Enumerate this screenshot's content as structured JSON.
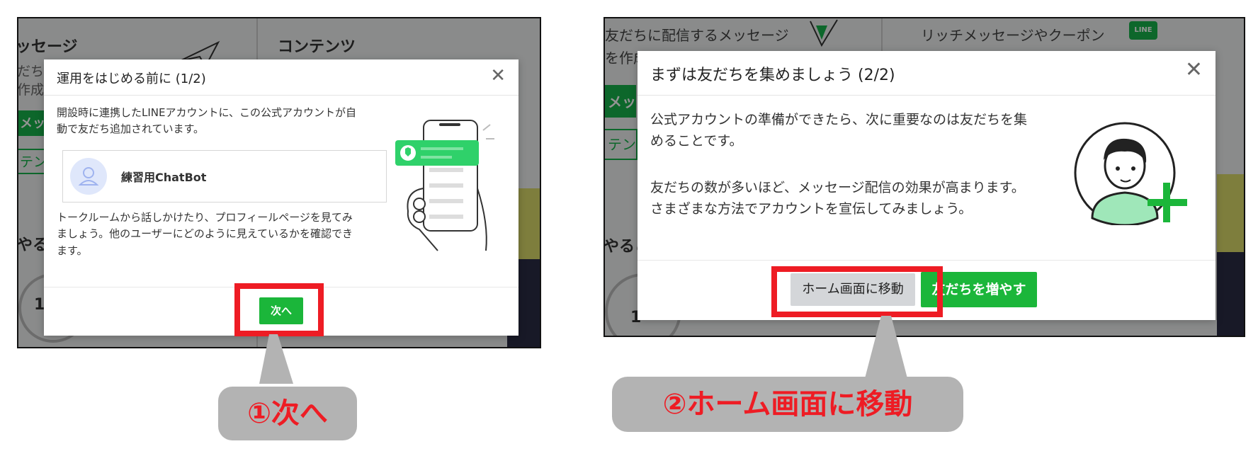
{
  "panel1": {
    "bg": {
      "heading_left": "ッセージ",
      "heading_right": "コンテンツ",
      "snippet1": "だち",
      "snippet2": "作成",
      "tab1": "メッ",
      "tab2": "テン",
      "section": "やるこ",
      "circle_number": "1"
    },
    "modal": {
      "title": "運用をはじめる前に (1/2)",
      "paragraph1_line1": "開設時に連携したLINEアカウントに、この公式アカウントが自",
      "paragraph1_line2": "動で友だち追加されています。",
      "account_name": "練習用ChatBot",
      "paragraph2_line1": "トークルームから話しかけたり、プロフィールページを見てみ",
      "paragraph2_line2": "ましょう。他のユーザーにどのように見えているかを確認でき",
      "paragraph2_line3": "ます。",
      "next_button": "次へ"
    }
  },
  "panel2": {
    "bg": {
      "line1_left": "友だちに配信するメッセージ",
      "line2_left": "を作成",
      "line1_right": "リッチメッセージやクーポン",
      "line_badge": "LINE",
      "tab1": "メッ",
      "tab2": "テン",
      "section": "やるこ",
      "circle_number": "1"
    },
    "modal": {
      "title": "まずは友だちを集めましょう (2/2)",
      "paragraph1_line1": "公式アカウントの準備ができたら、次に重要なのは友だちを集",
      "paragraph1_line2": "めることです。",
      "paragraph2_line1": "友だちの数が多いほど、メッセージ配信の効果が高まります。",
      "paragraph2_line2": "さまざまな方法でアカウントを宣伝してみましょう。",
      "home_button": "ホーム画面に移動",
      "add_friends_button": "友だちを増やす"
    }
  },
  "callouts": {
    "step1": "①次へ",
    "step2": "②ホーム画面に移動"
  },
  "colors": {
    "accent_red": "#ee1c24",
    "line_green": "#1bb63a",
    "callout_gray": "#b3b3b3"
  },
  "icons": [
    "close-icon",
    "user-avatar-icon",
    "phone-hand-illustration",
    "person-plus-illustration",
    "paper-plane-icon",
    "line-logo-icon"
  ]
}
